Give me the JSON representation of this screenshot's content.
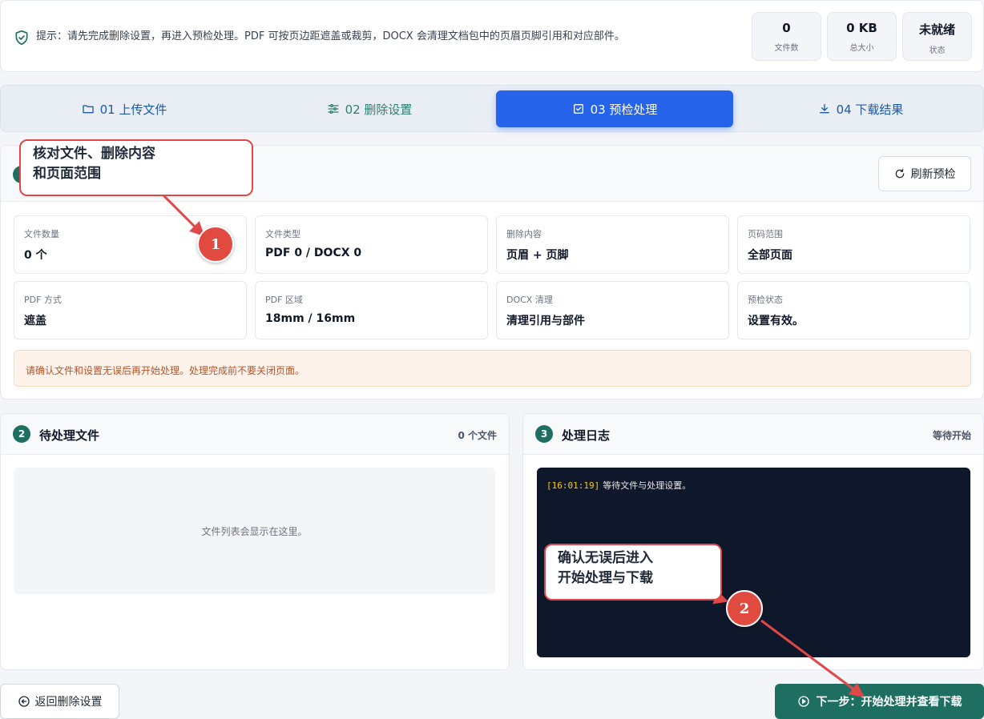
{
  "notice": {
    "icon": "shield-check-icon",
    "text": "提示：请先完成删除设置，再进入预检处理。PDF 可按页边距遮盖或裁剪，DOCX 会清理文档包中的页眉页脚引用和对应部件。"
  },
  "stats": [
    {
      "value": "0",
      "label": "文件数"
    },
    {
      "value": "0 KB",
      "label": "总大小"
    },
    {
      "value": "未就绪",
      "label": "状态"
    }
  ],
  "tabs": [
    {
      "label": "01 上传文件",
      "icon": "folder-icon",
      "active": false
    },
    {
      "label": "02 删除设置",
      "icon": "sliders-icon",
      "active": false
    },
    {
      "label": "03 预检处理",
      "icon": "check-square-icon",
      "active": true
    },
    {
      "label": "04 下载结果",
      "icon": "download-icon",
      "active": false
    }
  ],
  "review": {
    "refresh_label": "刷新预检",
    "items": [
      {
        "key": "文件数量",
        "value": "0 个"
      },
      {
        "key": "文件类型",
        "value": "PDF 0 / DOCX 0"
      },
      {
        "key": "删除内容",
        "value": "页眉 + 页脚"
      },
      {
        "key": "页码范围",
        "value": "全部页面"
      },
      {
        "key": "PDF 方式",
        "value": "遮盖"
      },
      {
        "key": "PDF 区域",
        "value": "18mm / 16mm"
      },
      {
        "key": "DOCX 清理",
        "value": "清理引用与部件"
      },
      {
        "key": "预检状态",
        "value": "设置有效。"
      }
    ],
    "warning": "请确认文件和设置无误后再开始处理。处理完成前不要关闭页面。"
  },
  "files_panel": {
    "number": "2",
    "title": "待处理文件",
    "meta": "0 个文件",
    "empty": "文件列表会显示在这里。"
  },
  "log_panel": {
    "number": "3",
    "title": "处理日志",
    "meta": "等待开始",
    "entries": [
      {
        "time": "[16:01:19]",
        "text": "等待文件与处理设置。"
      }
    ]
  },
  "buttons": {
    "back": "返回删除设置",
    "next": "下一步：开始处理并查看下载"
  },
  "annotations": [
    {
      "number": "1",
      "line1": "核对文件、删除内容",
      "line2": "和页面范围"
    },
    {
      "number": "2",
      "line1": "确认无误后进入",
      "line2": "开始处理与下载"
    }
  ],
  "colors": {
    "primary": "#2563eb",
    "teal": "#1f6e62",
    "annotation": "#e04848",
    "log_bg": "#0f172a"
  }
}
